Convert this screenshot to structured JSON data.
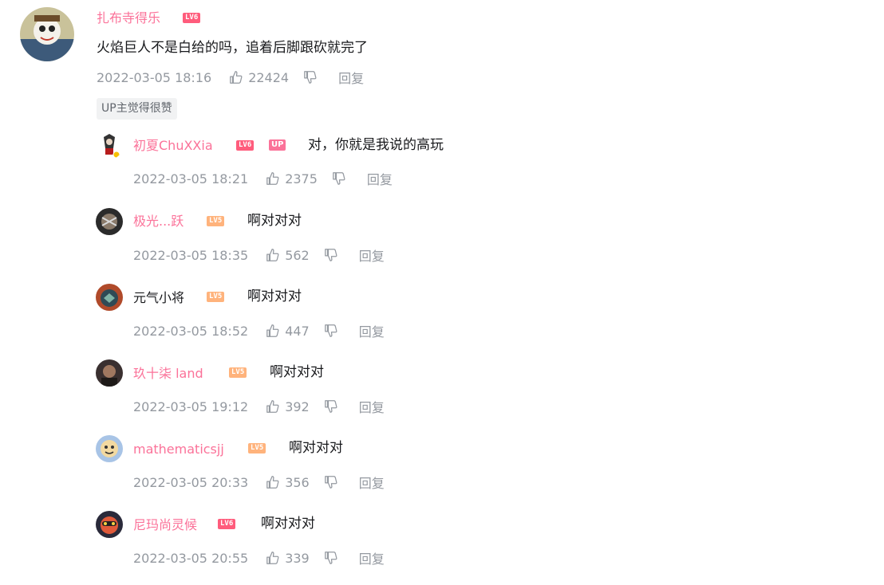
{
  "main_comment": {
    "username": "扎布寺得乐",
    "level": "LV6",
    "text": "火焰巨人不是白给的吗，追着后脚跟砍就完了",
    "time": "2022-03-05 18:16",
    "likes": "22424",
    "reply_label": "回复",
    "up_liked_tag": "UP主觉得很赞"
  },
  "replies": [
    {
      "username": "初夏ChuXXia",
      "level": "LV6",
      "up_badge": "UP",
      "text": "对，你就是我说的高玩",
      "time": "2022-03-05 18:21",
      "likes": "2375",
      "reply_label": "回复"
    },
    {
      "username": "极光...跃",
      "level": "LV5",
      "text": "啊对对对",
      "time": "2022-03-05 18:35",
      "likes": "562",
      "reply_label": "回复"
    },
    {
      "username": "元气小将",
      "level": "LV5",
      "text": "啊对对对",
      "time": "2022-03-05 18:52",
      "likes": "447",
      "reply_label": "回复"
    },
    {
      "username": "玖十柒 land",
      "level": "LV5",
      "text": "啊对对对",
      "time": "2022-03-05 19:12",
      "likes": "392",
      "reply_label": "回复"
    },
    {
      "username": "mathematicsjj",
      "level": "LV5",
      "text": "啊对对对",
      "time": "2022-03-05 20:33",
      "likes": "356",
      "reply_label": "回复"
    },
    {
      "username": "尼玛尚灵候",
      "level": "LV6",
      "text": "啊对对对",
      "time": "2022-03-05 20:55",
      "likes": "339",
      "reply_label": "回复"
    }
  ],
  "colors": {
    "username": "#fb7299",
    "meta": "#9499a0",
    "lv5": "#ffb37c",
    "lv6": "#ff5c7c"
  },
  "icons": [
    "thumb-up-icon",
    "thumb-down-icon"
  ]
}
